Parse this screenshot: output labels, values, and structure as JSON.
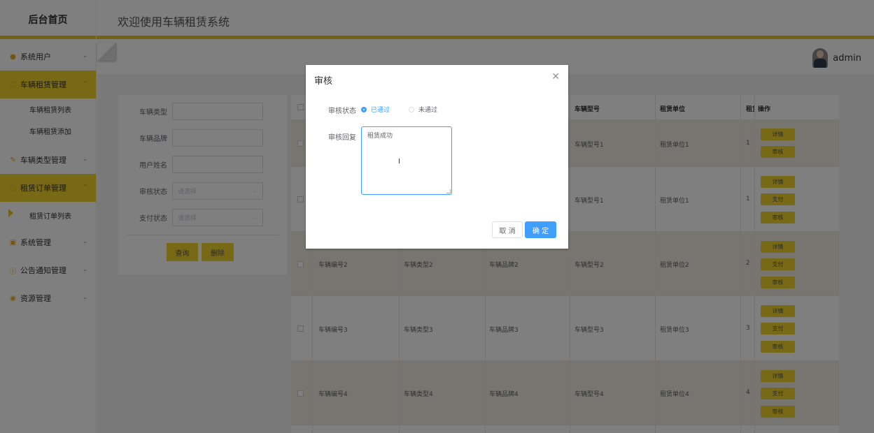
{
  "header": {
    "brand": "后台首页",
    "welcome": "欢迎使用车辆租赁系统"
  },
  "user": {
    "name": "admin"
  },
  "sidebar": {
    "items": [
      {
        "label": "系统用户",
        "icon": "user-icon"
      },
      {
        "label": "车辆租赁管理",
        "icon": "folder-icon",
        "active": true,
        "children": [
          {
            "label": "车辆租赁列表"
          },
          {
            "label": "车辆租赁添加"
          }
        ]
      },
      {
        "label": "车辆类型管理",
        "icon": "edit-icon"
      },
      {
        "label": "租赁订单管理",
        "icon": "folder-icon",
        "active": true,
        "children": [
          {
            "label": "租赁订单列表"
          }
        ]
      },
      {
        "label": "系统管理",
        "icon": "picture-icon"
      },
      {
        "label": "公告通知管理",
        "icon": "info-icon"
      },
      {
        "label": "资源管理",
        "icon": "location-icon"
      }
    ]
  },
  "search": {
    "fields": [
      {
        "label": "车辆类型",
        "value": ""
      },
      {
        "label": "车辆品牌",
        "value": ""
      },
      {
        "label": "用户姓名",
        "value": ""
      },
      {
        "label": "审核状态",
        "placeholder": "请选择"
      },
      {
        "label": "支付状态",
        "placeholder": "请选择"
      }
    ],
    "query_label": "查询",
    "delete_label": "删除"
  },
  "table": {
    "headers": {
      "model": "车辆型号",
      "unit": "租赁单位",
      "rent": "租赁",
      "ops": "操作"
    },
    "rows": [
      {
        "no": "",
        "type": "",
        "brand": "",
        "model": "车辆型号1",
        "unit": "租赁单位1",
        "rent": "1",
        "actions": [
          "详情",
          "审核"
        ]
      },
      {
        "no": "",
        "type": "",
        "brand": "",
        "model": "车辆型号1",
        "unit": "租赁单位1",
        "rent": "1",
        "actions": [
          "详情",
          "支付",
          "审核"
        ]
      },
      {
        "no": "车辆编号2",
        "type": "车辆类型2",
        "brand": "车辆品牌2",
        "model": "车辆型号2",
        "unit": "租赁单位2",
        "rent": "2",
        "actions": [
          "详情",
          "支付",
          "审核"
        ]
      },
      {
        "no": "车辆编号3",
        "type": "车辆类型3",
        "brand": "车辆品牌3",
        "model": "车辆型号3",
        "unit": "租赁单位3",
        "rent": "3",
        "actions": [
          "详情",
          "支付",
          "审核"
        ]
      },
      {
        "no": "车辆编号4",
        "type": "车辆类型4",
        "brand": "车辆品牌4",
        "model": "车辆型号4",
        "unit": "租赁单位4",
        "rent": "4",
        "actions": [
          "详情",
          "支付",
          "审核"
        ]
      }
    ]
  },
  "dialog": {
    "title": "审核",
    "status_label": "审核状态",
    "options": [
      {
        "label": "已通过",
        "checked": true
      },
      {
        "label": "未通过",
        "checked": false
      }
    ],
    "reply_label": "审核回复",
    "reply_value": "租赁成功",
    "cancel_label": "取 消",
    "confirm_label": "确 定"
  }
}
